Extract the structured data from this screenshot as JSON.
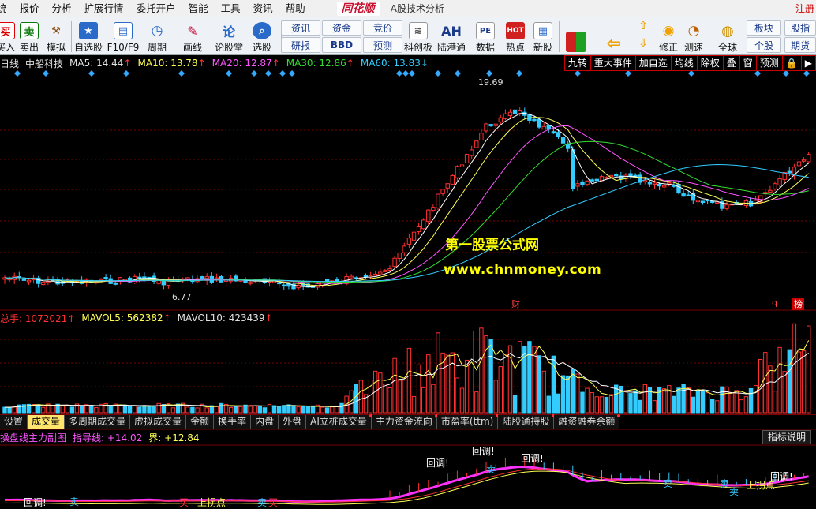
{
  "menu": {
    "items": [
      "统",
      "报价",
      "分析",
      "扩展行情",
      "委托开户",
      "智能",
      "工具",
      "资讯",
      "帮助"
    ],
    "logo": "同花顺",
    "app_title": "- A股技术分析",
    "register": "注册"
  },
  "toolbar": {
    "buttons": [
      {
        "label": "买入",
        "icon": "buy-icon",
        "color": "#d00000"
      },
      {
        "label": "卖出",
        "icon": "sell-icon",
        "color": "#0a7a0a"
      },
      {
        "label": "模拟",
        "icon": "hammer-icon"
      },
      {
        "label": "自选股",
        "icon": "star-icon"
      },
      {
        "label": "F10/F9",
        "icon": "f10-icon"
      },
      {
        "label": "周期",
        "icon": "clock-icon"
      },
      {
        "label": "画线",
        "icon": "pencil-icon"
      },
      {
        "label": "论股堂",
        "icon": "forum-icon"
      },
      {
        "label": "选股",
        "icon": "magnifier-icon"
      },
      {
        "label": "科创板",
        "icon": "sci-icon"
      },
      {
        "label": "陆港通",
        "icon": "ah-icon"
      },
      {
        "label": "数据",
        "icon": "pe-icon"
      },
      {
        "label": "热点",
        "icon": "hot-icon"
      },
      {
        "label": "新股",
        "icon": "new-stock-icon"
      },
      {
        "label": "修正",
        "icon": "correct-icon"
      },
      {
        "label": "测速",
        "icon": "speed-icon"
      },
      {
        "label": "全球",
        "icon": "globe-icon"
      }
    ],
    "small_buttons": [
      "资讯",
      "研报",
      "资金",
      "BBD",
      "竞价",
      "预测",
      "板块",
      "个股",
      "股指",
      "期货"
    ]
  },
  "main_header": {
    "period": "日线",
    "stock": "中船科技",
    "ma5": "MA5: 14.44",
    "ma10": "MA10: 13.78",
    "ma20": "MA20: 12.87",
    "ma30": "MA30: 12.86",
    "ma60": "MA60: 13.83",
    "up_arrow": "↑",
    "down_arrow": "↓"
  },
  "right_tools": [
    "九转",
    "重大事件",
    "加自选",
    "均线",
    "除权",
    "叠",
    "窗",
    "预测",
    "🔒",
    "▶"
  ],
  "price_labels": {
    "high": "19.69",
    "low": "6.77",
    "cai": "财",
    "q": "q",
    "bang": "榜"
  },
  "watermark": {
    "line1": "第一股票公式网",
    "line2": "www.chnmoney.com"
  },
  "volume_header": {
    "total": "总手: 1072021",
    "mavol5": "MAVOL5: 562382",
    "mavol10": "MAVOL10: 423439"
  },
  "tabs": [
    {
      "label": "设置",
      "active": false
    },
    {
      "label": "成交量",
      "active": true
    },
    {
      "label": "多周期成交量",
      "active": false
    },
    {
      "label": "虚拟成交量",
      "active": false
    },
    {
      "label": "金额",
      "active": false
    },
    {
      "label": "换手率",
      "active": false
    },
    {
      "label": "内盘",
      "active": false
    },
    {
      "label": "外盘",
      "active": false
    },
    {
      "label": "AI立桩成交量",
      "active": false,
      "dot": true
    },
    {
      "label": "主力资金流向",
      "active": false,
      "dot": true
    },
    {
      "label": "市盈率(ttm)",
      "active": false,
      "dot": true
    },
    {
      "label": "陆股通持股",
      "active": false,
      "dot": true
    },
    {
      "label": "融资融券余额",
      "active": false,
      "dot": true
    }
  ],
  "indicator_header": {
    "name": "操盘线主力副图",
    "guide": "指导线: +14.02",
    "jie": "界: +12.84"
  },
  "indicator_button": "指标说明",
  "indicator_labels": {
    "huidiao": "回调!",
    "sell": "卖",
    "buy": "买",
    "up_turn": "上拐点"
  },
  "colors": {
    "up": "#ff3030",
    "down": "#33ccff",
    "ma5": "#ffffff",
    "ma10": "#ffff55",
    "ma20": "#ff55ff",
    "ma30": "#33dd33",
    "ma60": "#33ccff",
    "grid": "#7a0000"
  }
}
